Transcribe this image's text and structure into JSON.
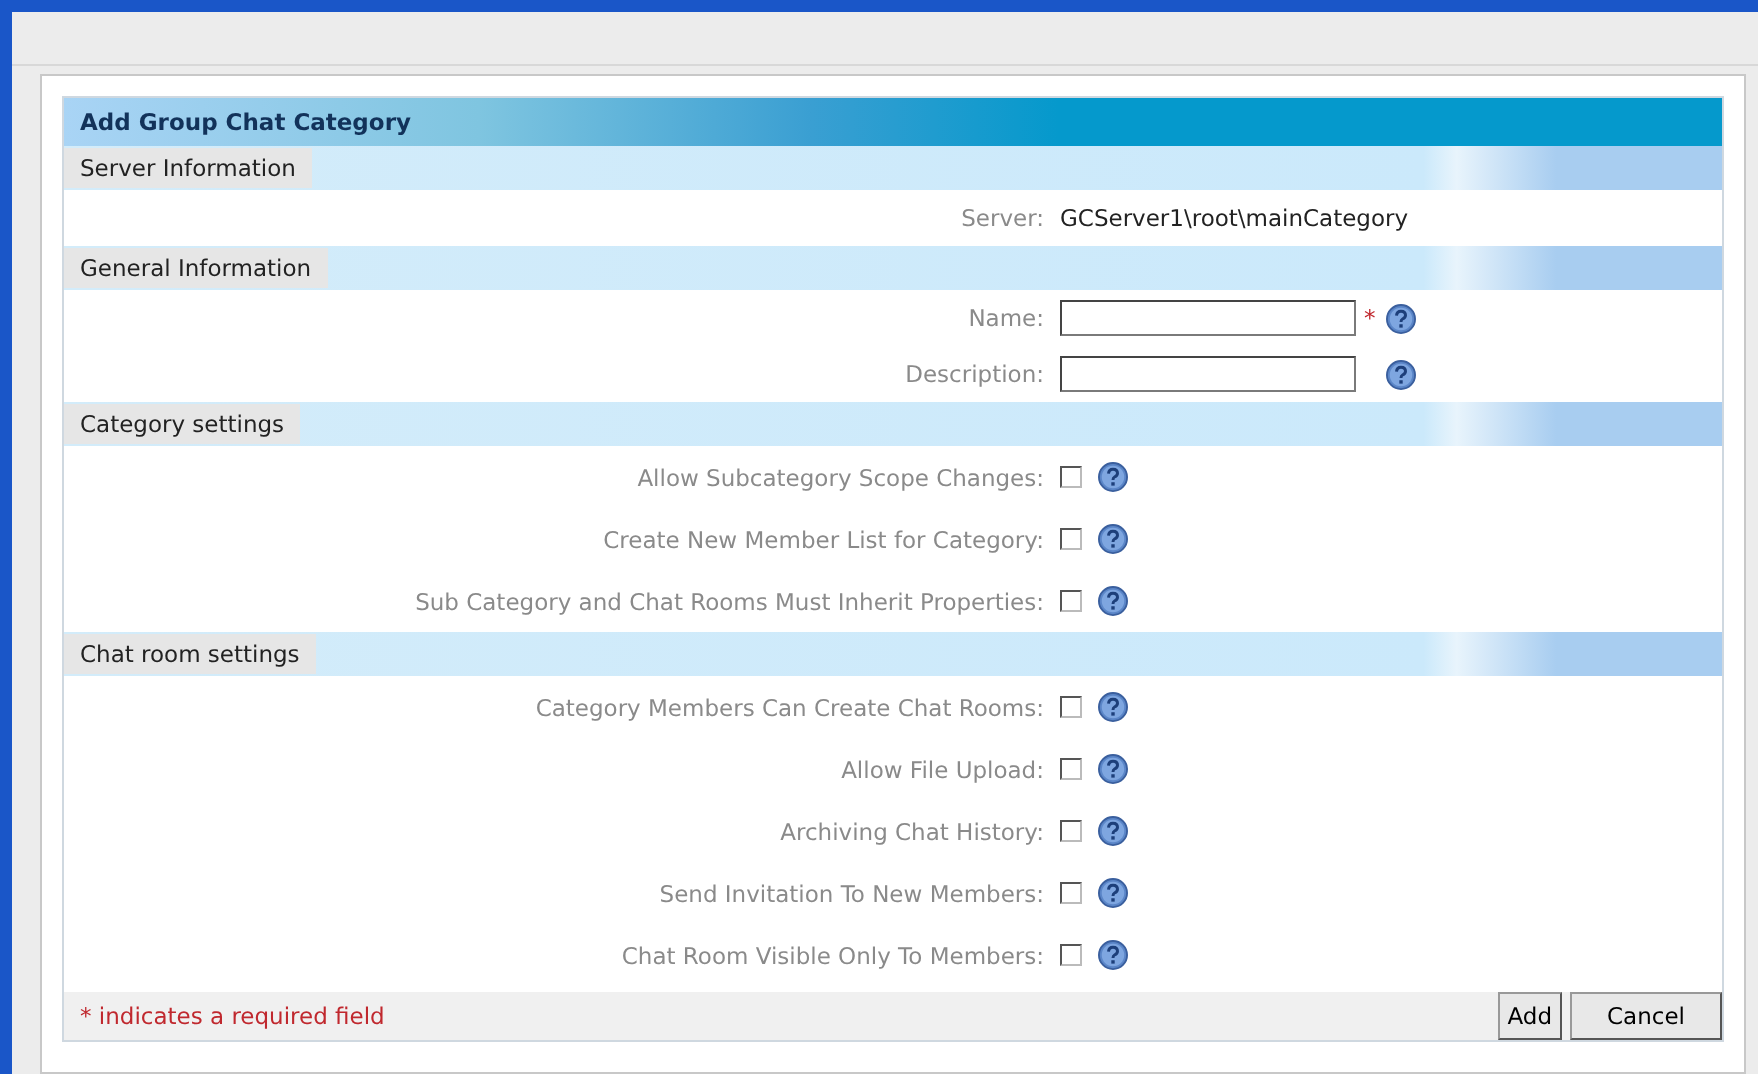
{
  "dialog": {
    "title": "Add Group Chat Category"
  },
  "sections": [
    {
      "title": "Server Information",
      "rows": [
        {
          "kind": "info",
          "label": "Server:",
          "value": "GCServer1\\root\\mainCategory"
        }
      ]
    },
    {
      "title": "General Information",
      "rows": [
        {
          "kind": "text",
          "label": "Name:",
          "required_mark": "*"
        },
        {
          "kind": "text",
          "label": "Description:"
        }
      ]
    },
    {
      "title": "Category settings",
      "rows": [
        {
          "kind": "checkbox",
          "label": "Allow Subcategory Scope Changes:",
          "checked": false
        },
        {
          "kind": "checkbox",
          "label": "Create New Member List for Category:",
          "checked": false
        },
        {
          "kind": "checkbox",
          "label": "Sub Category and Chat Rooms Must Inherit Properties:",
          "checked": false
        }
      ]
    },
    {
      "title": "Chat room settings",
      "rows": [
        {
          "kind": "checkbox",
          "label": "Category Members Can Create Chat Rooms:",
          "checked": false
        },
        {
          "kind": "checkbox",
          "label": "Allow File Upload:",
          "checked": false
        },
        {
          "kind": "checkbox",
          "label": "Archiving Chat History:",
          "checked": false
        },
        {
          "kind": "checkbox",
          "label": "Send Invitation To New Members:",
          "checked": false
        },
        {
          "kind": "checkbox",
          "label": "Chat Room Visible Only To Members:",
          "checked": false
        }
      ]
    }
  ],
  "footer": {
    "note": "* indicates a required field",
    "buttons": [
      "Add",
      "Cancel"
    ]
  }
}
